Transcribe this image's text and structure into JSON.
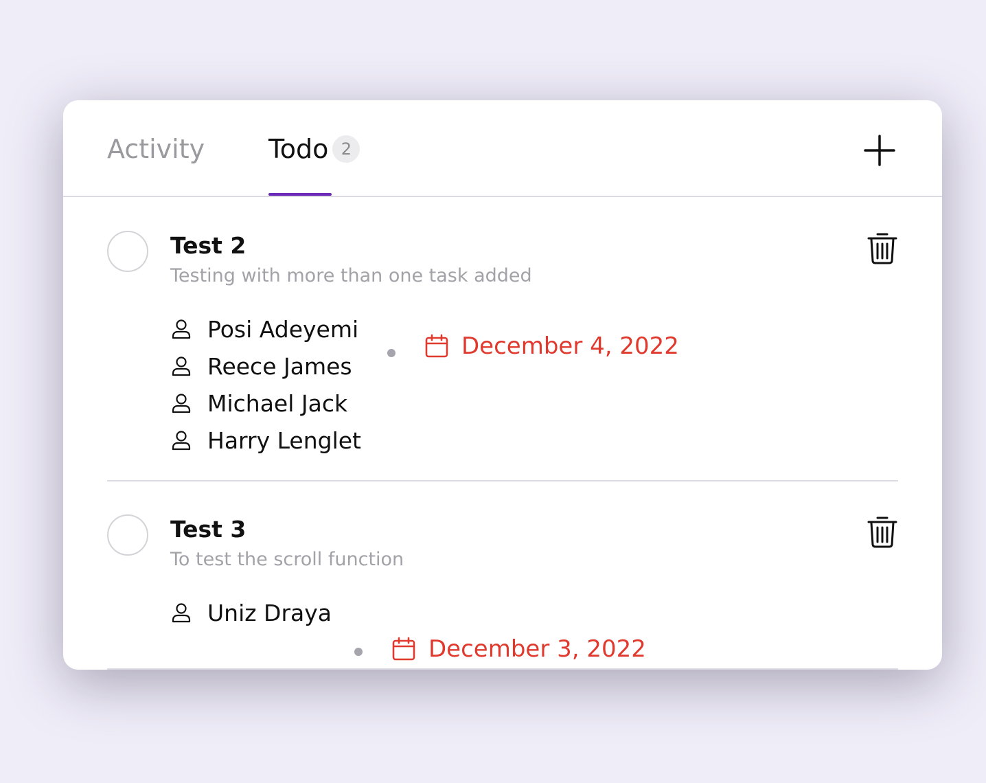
{
  "tabs": {
    "activity_label": "Activity",
    "todo_label": "Todo",
    "todo_count": "2"
  },
  "colors": {
    "accent": "#6b2bb8",
    "due_date": "#e03a2f",
    "background": "#efedf8"
  },
  "icons": {
    "add": "plus-icon",
    "delete": "trash-icon",
    "assignee": "person-icon",
    "due": "calendar-icon"
  },
  "tasks": [
    {
      "title": "Test 2",
      "description": "Testing with more than one task added",
      "assignees": [
        "Posi Adeyemi",
        "Reece James",
        "Michael Jack",
        "Harry Lenglet"
      ],
      "due_date": "December 4, 2022"
    },
    {
      "title": "Test 3",
      "description": "To test the scroll function",
      "assignees": [
        "Uniz Draya"
      ],
      "due_date": "December 3, 2022"
    }
  ]
}
